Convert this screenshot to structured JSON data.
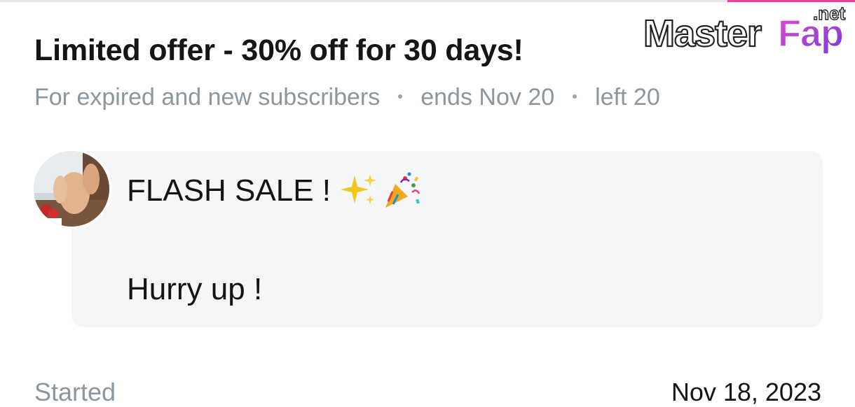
{
  "offer": {
    "title": "Limited offer - 30% off for 30 days!",
    "audience": "For expired and new subscribers",
    "ends": "ends Nov 20",
    "left": "left 20"
  },
  "message": {
    "line1": "FLASH SALE !",
    "line2": "Hurry up !",
    "emojis": [
      "sparkles-icon",
      "party-popper-icon"
    ]
  },
  "details": {
    "started_label": "Started",
    "started_value": "Nov 18, 2023"
  },
  "watermark": {
    "text": "MasterFap",
    "suffix": ".net"
  },
  "colors": {
    "title": "#151515",
    "meta": "#8a96a0",
    "bubble": "#f4f6f7",
    "watermark_pink": "#d646c6",
    "watermark_purple": "#8a3fd6"
  }
}
